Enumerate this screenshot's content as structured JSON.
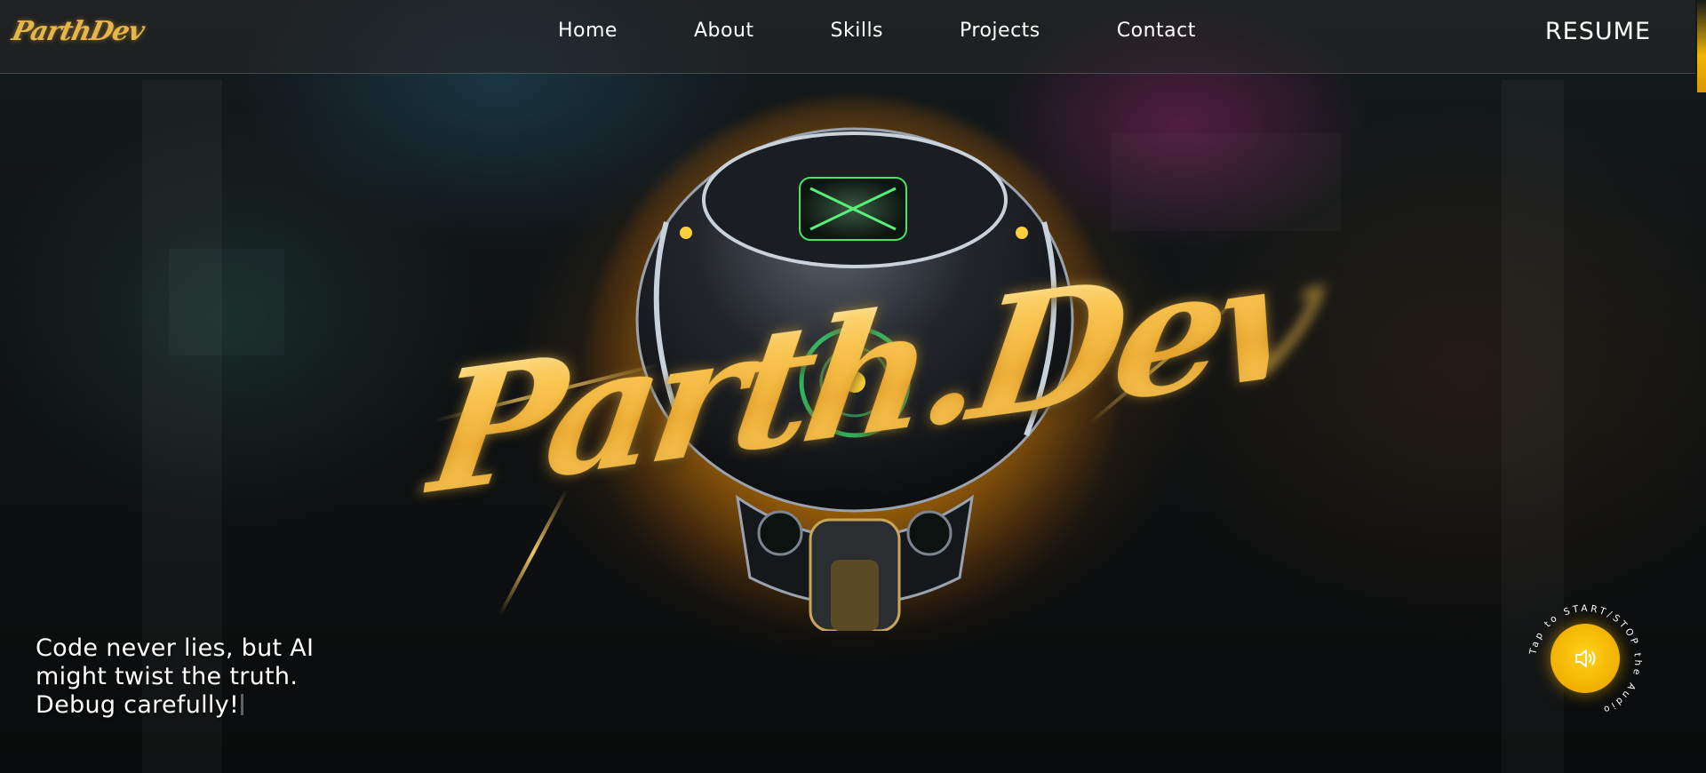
{
  "brand": {
    "logo_text": "ParthDev",
    "hero_title": "Parth.Dev"
  },
  "nav": {
    "items": [
      {
        "label": "Home"
      },
      {
        "label": "About"
      },
      {
        "label": "Skills"
      },
      {
        "label": "Projects"
      },
      {
        "label": "Contact"
      }
    ],
    "resume_label": "RESUME"
  },
  "hero": {
    "quote_line_1": "Code never lies, but AI",
    "quote_line_2": "might twist the truth.",
    "quote_line_3": "Debug carefully!"
  },
  "audio": {
    "ring_text": "Tap to START/STOP the Audio",
    "icon": "speaker-icon"
  },
  "colors": {
    "accent": "#f0b400",
    "text": "#ffffff",
    "gold": "#e9b23c"
  }
}
